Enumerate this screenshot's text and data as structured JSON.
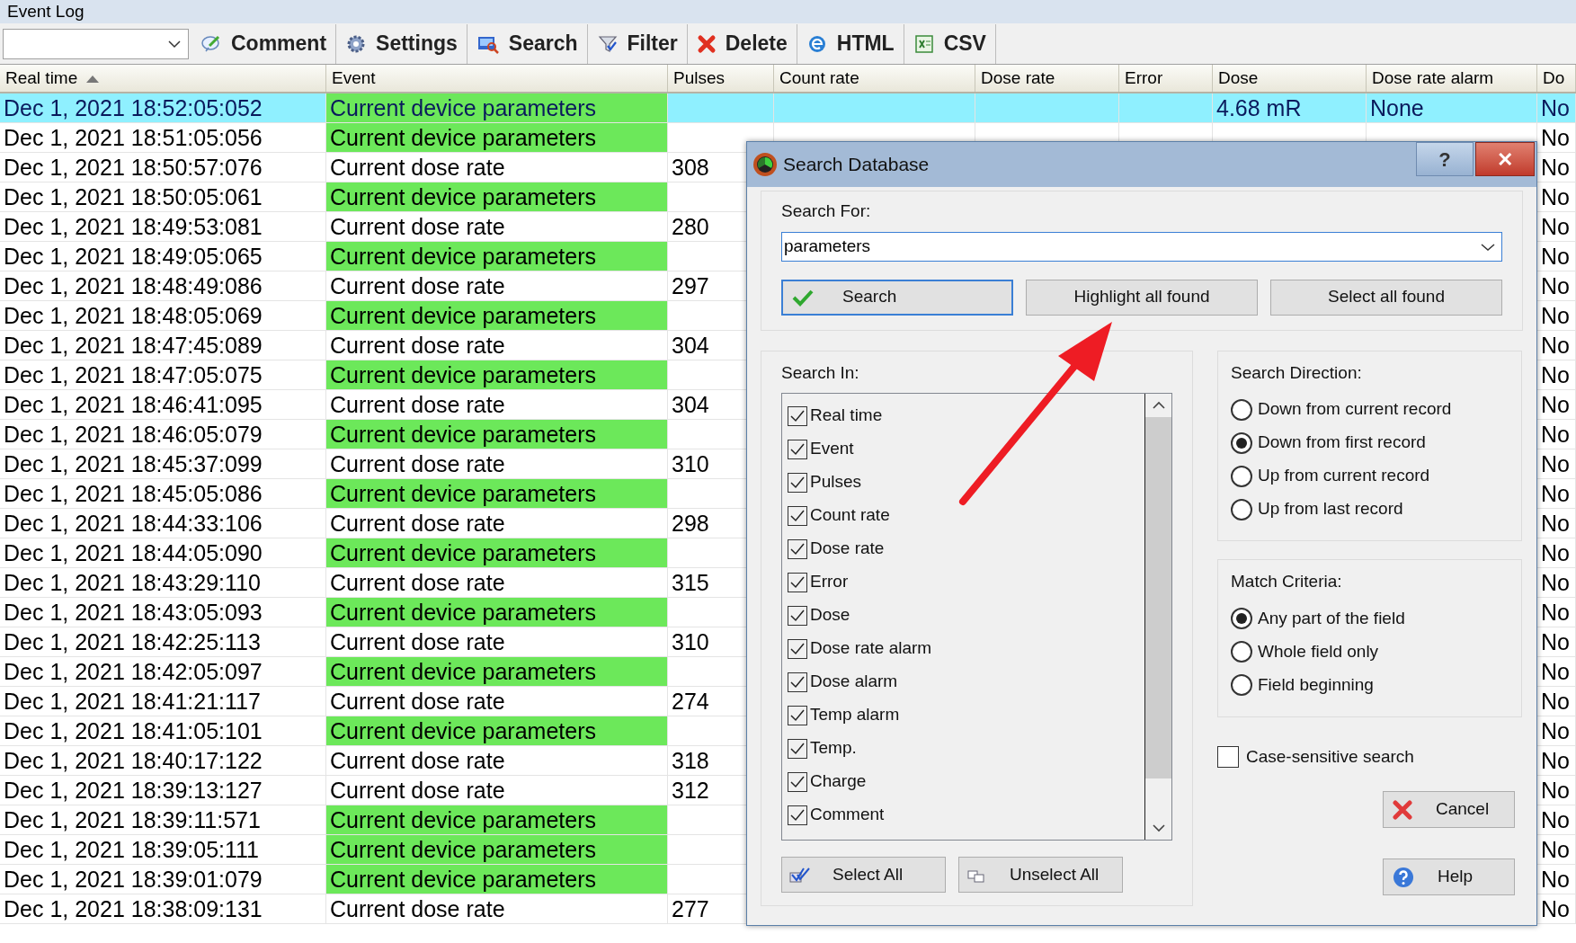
{
  "window": {
    "title": "Event Log"
  },
  "toolbar": {
    "buttons": [
      {
        "label": "Comment",
        "kind": "comment"
      },
      {
        "label": "Settings",
        "kind": "settings"
      },
      {
        "label": "Search",
        "kind": "search"
      },
      {
        "label": "Filter",
        "kind": "filter"
      },
      {
        "label": "Delete",
        "kind": "delete"
      },
      {
        "label": "HTML",
        "kind": "html"
      },
      {
        "label": "CSV",
        "kind": "csv"
      }
    ]
  },
  "table": {
    "columns": [
      {
        "label": "Real time",
        "sorted": true
      },
      {
        "label": "Event",
        "sorted": false
      },
      {
        "label": "Pulses",
        "sorted": false
      },
      {
        "label": "Count rate",
        "sorted": false
      },
      {
        "label": "Dose rate",
        "sorted": false
      },
      {
        "label": "Error",
        "sorted": false
      },
      {
        "label": "Dose",
        "sorted": false
      },
      {
        "label": "Dose rate alarm",
        "sorted": false
      },
      {
        "label": "Do",
        "sorted": false
      }
    ],
    "rows": [
      {
        "time": "Dec 1, 2021  18:52:05:052",
        "event": "Current device parameters",
        "kind": "parameters",
        "selected": true,
        "dose": "4.68 mR",
        "alarm": "None",
        "column_9": "No"
      },
      {
        "time": "Dec 1, 2021  18:51:05:056",
        "event": "Current device parameters",
        "kind": "parameters",
        "selected": false,
        "column_9": "No"
      },
      {
        "time": "Dec 1, 2021  18:50:57:076",
        "event": "Current dose rate",
        "kind": "dose_rate",
        "selected": false,
        "pulses": "308",
        "column_9": "No"
      },
      {
        "time": "Dec 1, 2021  18:50:05:061",
        "event": "Current device parameters",
        "kind": "parameters",
        "selected": false,
        "column_9": "No"
      },
      {
        "time": "Dec 1, 2021  18:49:53:081",
        "event": "Current dose rate",
        "kind": "dose_rate",
        "selected": false,
        "pulses": "280",
        "column_9": "No"
      },
      {
        "time": "Dec 1, 2021  18:49:05:065",
        "event": "Current device parameters",
        "kind": "parameters",
        "selected": false,
        "column_9": "No"
      },
      {
        "time": "Dec 1, 2021  18:48:49:086",
        "event": "Current dose rate",
        "kind": "dose_rate",
        "selected": false,
        "pulses": "297",
        "column_9": "No"
      },
      {
        "time": "Dec 1, 2021  18:48:05:069",
        "event": "Current device parameters",
        "kind": "parameters",
        "selected": false,
        "column_9": "No"
      },
      {
        "time": "Dec 1, 2021  18:47:45:089",
        "event": "Current dose rate",
        "kind": "dose_rate",
        "selected": false,
        "pulses": "304",
        "column_9": "No"
      },
      {
        "time": "Dec 1, 2021  18:47:05:075",
        "event": "Current device parameters",
        "kind": "parameters",
        "selected": false,
        "column_9": "No"
      },
      {
        "time": "Dec 1, 2021  18:46:41:095",
        "event": "Current dose rate",
        "kind": "dose_rate",
        "selected": false,
        "pulses": "304",
        "column_9": "No"
      },
      {
        "time": "Dec 1, 2021  18:46:05:079",
        "event": "Current device parameters",
        "kind": "parameters",
        "selected": false,
        "column_9": "No"
      },
      {
        "time": "Dec 1, 2021  18:45:37:099",
        "event": "Current dose rate",
        "kind": "dose_rate",
        "selected": false,
        "pulses": "310",
        "column_9": "No"
      },
      {
        "time": "Dec 1, 2021  18:45:05:086",
        "event": "Current device parameters",
        "kind": "parameters",
        "selected": false,
        "column_9": "No"
      },
      {
        "time": "Dec 1, 2021  18:44:33:106",
        "event": "Current dose rate",
        "kind": "dose_rate",
        "selected": false,
        "pulses": "298",
        "column_9": "No"
      },
      {
        "time": "Dec 1, 2021  18:44:05:090",
        "event": "Current device parameters",
        "kind": "parameters",
        "selected": false,
        "column_9": "No"
      },
      {
        "time": "Dec 1, 2021  18:43:29:110",
        "event": "Current dose rate",
        "kind": "dose_rate",
        "selected": false,
        "pulses": "315",
        "column_9": "No"
      },
      {
        "time": "Dec 1, 2021  18:43:05:093",
        "event": "Current device parameters",
        "kind": "parameters",
        "selected": false,
        "column_9": "No"
      },
      {
        "time": "Dec 1, 2021  18:42:25:113",
        "event": "Current dose rate",
        "kind": "dose_rate",
        "selected": false,
        "pulses": "310",
        "column_9": "No"
      },
      {
        "time": "Dec 1, 2021  18:42:05:097",
        "event": "Current device parameters",
        "kind": "parameters",
        "selected": false,
        "column_9": "No"
      },
      {
        "time": "Dec 1, 2021  18:41:21:117",
        "event": "Current dose rate",
        "kind": "dose_rate",
        "selected": false,
        "pulses": "274",
        "column_9": "No"
      },
      {
        "time": "Dec 1, 2021  18:41:05:101",
        "event": "Current device parameters",
        "kind": "parameters",
        "selected": false,
        "column_9": "No"
      },
      {
        "time": "Dec 1, 2021  18:40:17:122",
        "event": "Current dose rate",
        "kind": "dose_rate",
        "selected": false,
        "pulses": "318",
        "column_9": "No"
      },
      {
        "time": "Dec 1, 2021  18:39:13:127",
        "event": "Current dose rate",
        "kind": "dose_rate",
        "selected": false,
        "pulses": "312",
        "column_9": "No"
      },
      {
        "time": "Dec 1, 2021  18:39:11:571",
        "event": "Current device parameters",
        "kind": "parameters",
        "selected": false,
        "column_9": "No"
      },
      {
        "time": "Dec 1, 2021  18:39:05:111",
        "event": "Current device parameters",
        "kind": "parameters",
        "selected": false,
        "column_9": "No"
      },
      {
        "time": "Dec 1, 2021  18:39:01:079",
        "event": "Current device parameters",
        "kind": "parameters",
        "selected": false,
        "column_9": "No"
      },
      {
        "time": "Dec 1, 2021  18:38:09:131",
        "event": "Current dose rate",
        "kind": "dose_rate",
        "selected": false,
        "pulses": "277",
        "column_9": "No"
      }
    ]
  },
  "dialog": {
    "title": "Search Database",
    "help_button": "?",
    "close_button": "✕",
    "search_for": {
      "label": "Search For:",
      "value": "parameters"
    },
    "action_buttons": [
      {
        "label": "Search",
        "kind": "search"
      },
      {
        "label": "Highlight all found",
        "kind": "plain"
      },
      {
        "label": "Select all found",
        "kind": "plain"
      }
    ],
    "search_in": {
      "label": "Search In:",
      "fields": [
        {
          "label": "Real time",
          "checked": true
        },
        {
          "label": "Event",
          "checked": true
        },
        {
          "label": "Pulses",
          "checked": true
        },
        {
          "label": "Count rate",
          "checked": true
        },
        {
          "label": "Dose rate",
          "checked": true
        },
        {
          "label": "Error",
          "checked": true
        },
        {
          "label": "Dose",
          "checked": true
        },
        {
          "label": "Dose rate alarm",
          "checked": true
        },
        {
          "label": "Dose alarm",
          "checked": true
        },
        {
          "label": "Temp alarm",
          "checked": true
        },
        {
          "label": "Temp.",
          "checked": true
        },
        {
          "label": "Charge",
          "checked": true
        },
        {
          "label": "Comment",
          "checked": true
        }
      ],
      "buttons": [
        {
          "label": "Select All",
          "kind": "select"
        },
        {
          "label": "Unselect All",
          "kind": "unselect"
        }
      ]
    },
    "direction": {
      "label": "Search Direction:",
      "options": [
        {
          "label": "Down from current record",
          "selected": false
        },
        {
          "label": "Down from first record",
          "selected": true
        },
        {
          "label": "Up from current record",
          "selected": false
        },
        {
          "label": "Up from last record",
          "selected": false
        }
      ]
    },
    "criteria": {
      "label": "Match Criteria:",
      "options": [
        {
          "label": "Any part of the field",
          "selected": true
        },
        {
          "label": "Whole field only",
          "selected": false
        },
        {
          "label": "Field beginning",
          "selected": false
        }
      ]
    },
    "case_sensitive": {
      "label": "Case-sensitive search",
      "checked": false
    },
    "side_buttons": [
      {
        "label": "Cancel",
        "kind": "cancel"
      },
      {
        "label": "Help",
        "kind": "help"
      }
    ]
  }
}
